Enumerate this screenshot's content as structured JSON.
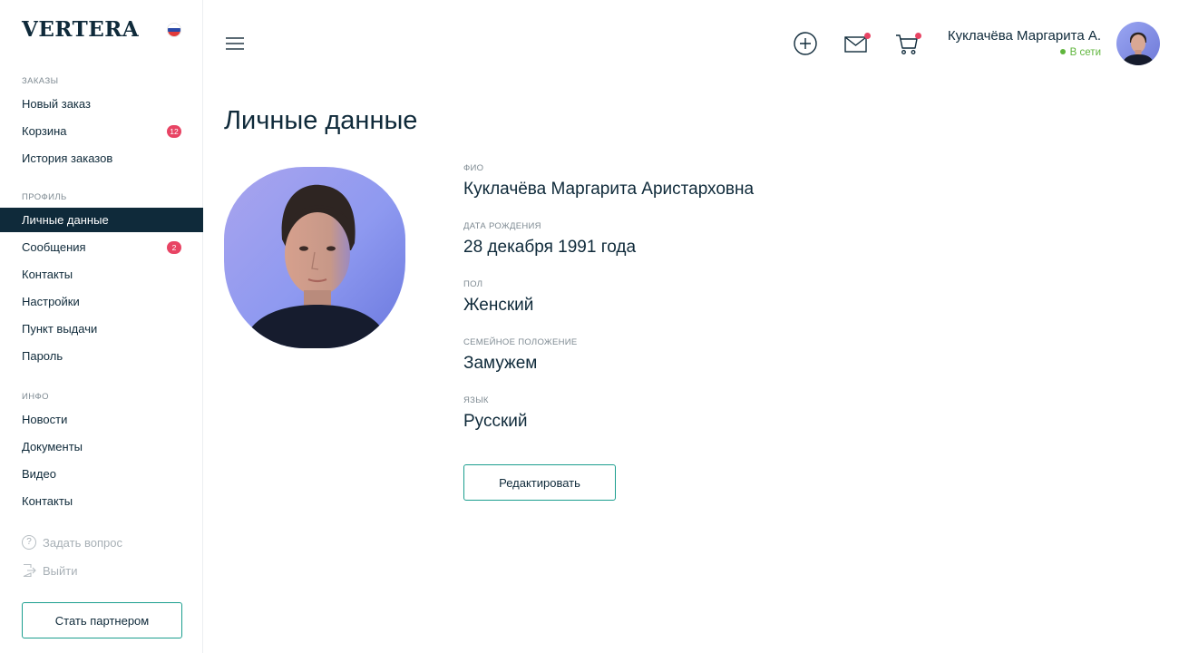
{
  "brand": {
    "logo": "VERTERA",
    "flag_icon": "russia-flag-icon"
  },
  "sidebar": {
    "orders_label": "ЗАКАЗЫ",
    "orders": [
      {
        "label": "Новый заказ"
      },
      {
        "label": "Корзина",
        "badge": "12"
      },
      {
        "label": "История заказов"
      }
    ],
    "profile_label": "ПРОФИЛЬ",
    "profile": [
      {
        "label": "Личные данные",
        "active": true
      },
      {
        "label": "Сообщения",
        "badge": "2"
      },
      {
        "label": "Контакты"
      },
      {
        "label": "Настройки"
      },
      {
        "label": "Пункт выдачи"
      },
      {
        "label": "Пароль"
      }
    ],
    "info_label": "ИНФО",
    "info": [
      {
        "label": "Новости"
      },
      {
        "label": "Документы"
      },
      {
        "label": "Видео"
      },
      {
        "label": "Контакты"
      }
    ],
    "ask_question": "Задать вопрос",
    "logout": "Выйти",
    "partner_button": "Стать партнером"
  },
  "header": {
    "icons": [
      "menu-icon",
      "add-circle-icon",
      "mail-icon",
      "cart-icon"
    ],
    "user_name": "Куклачёва Маргарита А.",
    "user_status": "В сети"
  },
  "main": {
    "title": "Личные данные",
    "fields": [
      {
        "label": "ФИО",
        "value": "Куклачёва Маргарита Аристарховна"
      },
      {
        "label": "ДАТА РОЖДЕНИЯ",
        "value": "28 декабря 1991 года"
      },
      {
        "label": "ПОЛ",
        "value": "Женский"
      },
      {
        "label": "СЕМЕЙНОЕ ПОЛОЖЕНИЕ",
        "value": "Замужем"
      },
      {
        "label": "ЯЗЫК",
        "value": "Русский"
      }
    ],
    "edit_button": "Редактировать"
  },
  "colors": {
    "navy": "#0f2a3a",
    "accent": "#1b9e8e",
    "badge": "#e84464",
    "online": "#5fb53c"
  }
}
